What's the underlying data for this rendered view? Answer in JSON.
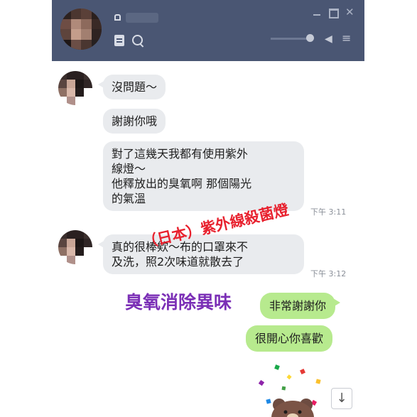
{
  "colors": {
    "header_bg": "#4a5673",
    "friend_bubble": "#e9ebee",
    "self_bubble": "#b7ea8e",
    "overlay_red": "#e8212e",
    "overlay_purple": "#7b2fb6"
  },
  "header": {
    "icons": [
      "lock-icon",
      "notes-icon",
      "search-icon",
      "minimize-icon",
      "maximize-icon",
      "close-icon",
      "speaker-icon",
      "menu-icon"
    ],
    "close_glyph": "✕",
    "speaker_glyph": "◀",
    "menu_glyph": "≡"
  },
  "messages": [
    {
      "from": "friend",
      "text": "沒問題～"
    },
    {
      "from": "friend",
      "text": "謝謝你哦"
    },
    {
      "from": "friend",
      "text": "對了這幾天我都有使用紫外\n線燈～\n他釋放出的臭氧啊 那個陽光\n的氣溫",
      "time": "下午 3:11"
    },
    {
      "from": "friend",
      "text": "真的很棒欸～布的口罩來不\n及洗，照2次味道就散去了",
      "time": "下午 3:12"
    },
    {
      "from": "self",
      "text": "非常謝謝你"
    },
    {
      "from": "self",
      "text": "很開心你喜歡"
    }
  ],
  "overlays": {
    "red": "（日本）紫外線殺菌燈",
    "purple": "臭氧消除異味"
  },
  "scroll_button": "↓"
}
